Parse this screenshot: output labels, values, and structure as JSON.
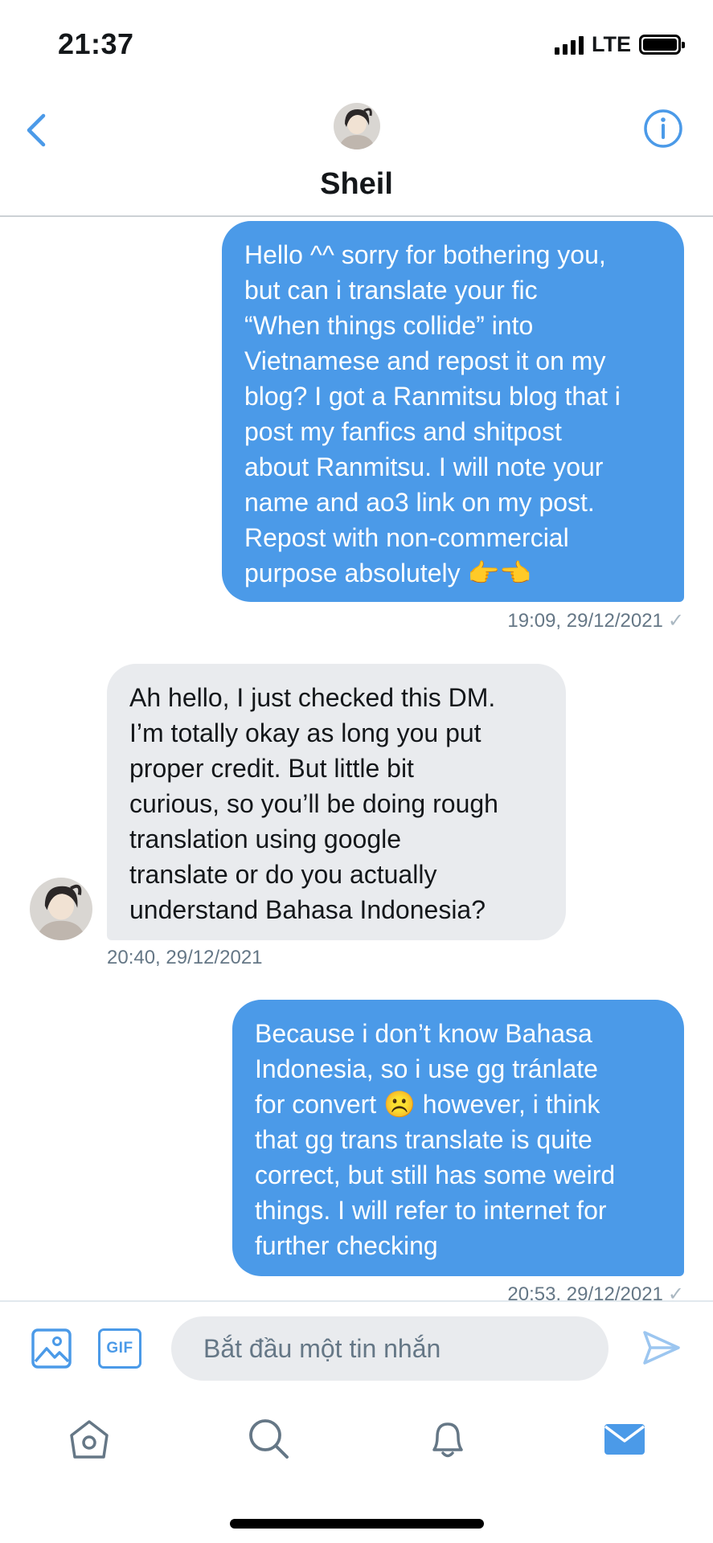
{
  "status_bar": {
    "time": "21:37",
    "network": "LTE"
  },
  "header": {
    "title": "Sheil",
    "back_icon": "chevron-left-icon",
    "info_icon": "info-icon"
  },
  "colors": {
    "accent": "#4b9ae8",
    "received_bubble": "#e9ebee",
    "meta_text": "#657786"
  },
  "messages": [
    {
      "direction": "sent",
      "lines": [
        "Hello ^^ sorry for bothering you,",
        "but can i translate your fic",
        "“When things collide” into",
        "Vietnamese and repost it on my",
        "blog? I got a Ranmitsu blog that i",
        "post my fanfics and shitpost",
        "about Ranmitsu. I will note your",
        "name and ao3 link on my post.",
        "Repost with non-commercial",
        "purpose absolutely 👉👈"
      ],
      "timestamp": "19:09, 29/12/2021",
      "status": "✓"
    },
    {
      "direction": "received",
      "lines": [
        "Ah hello, I just checked this DM.",
        "I’m totally okay as long you put",
        "proper credit. But little bit",
        "curious, so you’ll be doing rough",
        "translation using google",
        "translate or do you actually",
        "understand Bahasa Indonesia?"
      ],
      "timestamp": "20:40, 29/12/2021"
    },
    {
      "direction": "sent",
      "lines": [
        "Because i don’t know Bahasa",
        "Indonesia, so i use gg tránlate",
        "for convert ☹️ however, i think",
        "that gg trans translate is  quite",
        "correct, but still has some weird",
        "things. I will refer to internet for",
        "further checking"
      ],
      "timestamp": "20:53, 29/12/2021",
      "status": "✓"
    }
  ],
  "composer": {
    "placeholder": "Bắt đầu một tin nhắn",
    "gif_label": "GIF",
    "image_icon": "image-icon",
    "send_icon": "send-icon"
  },
  "tabbar": {
    "items": [
      {
        "icon": "home-icon",
        "active": false
      },
      {
        "icon": "search-icon",
        "active": false
      },
      {
        "icon": "bell-icon",
        "active": false
      },
      {
        "icon": "mail-icon",
        "active": true
      }
    ]
  }
}
